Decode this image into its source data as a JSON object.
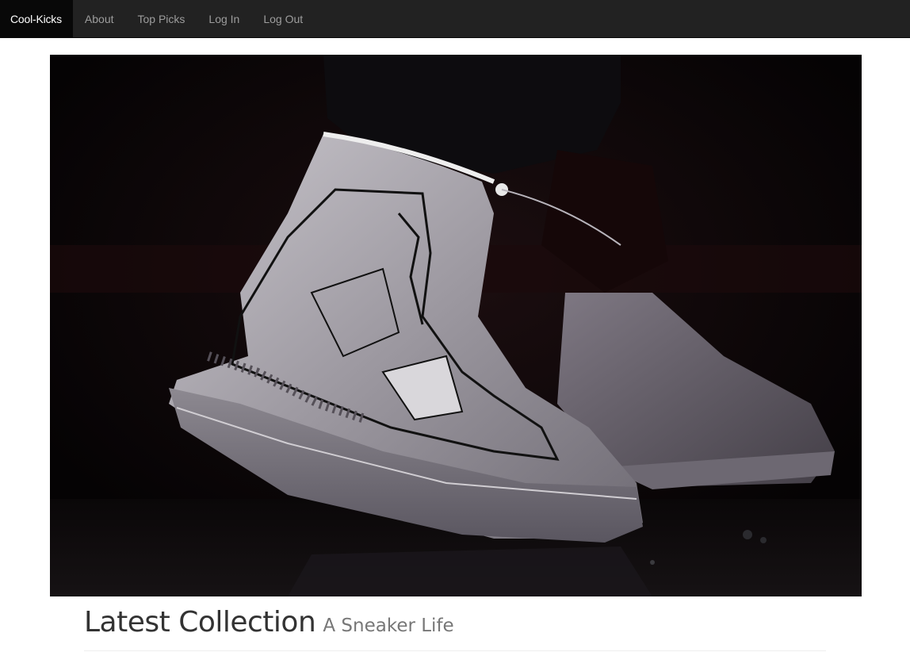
{
  "navbar": {
    "brand": "Cool-Kicks",
    "items": [
      {
        "label": "About"
      },
      {
        "label": "Top Picks"
      },
      {
        "label": "Log In"
      },
      {
        "label": "Log Out"
      }
    ],
    "bg_color": "#222222",
    "brand_bg_color": "#080808"
  },
  "hero": {
    "icon": "sneaker-photo",
    "bg_color": "#050304"
  },
  "main": {
    "title": "Latest Collection",
    "subtitle": "A Sneaker Life"
  }
}
